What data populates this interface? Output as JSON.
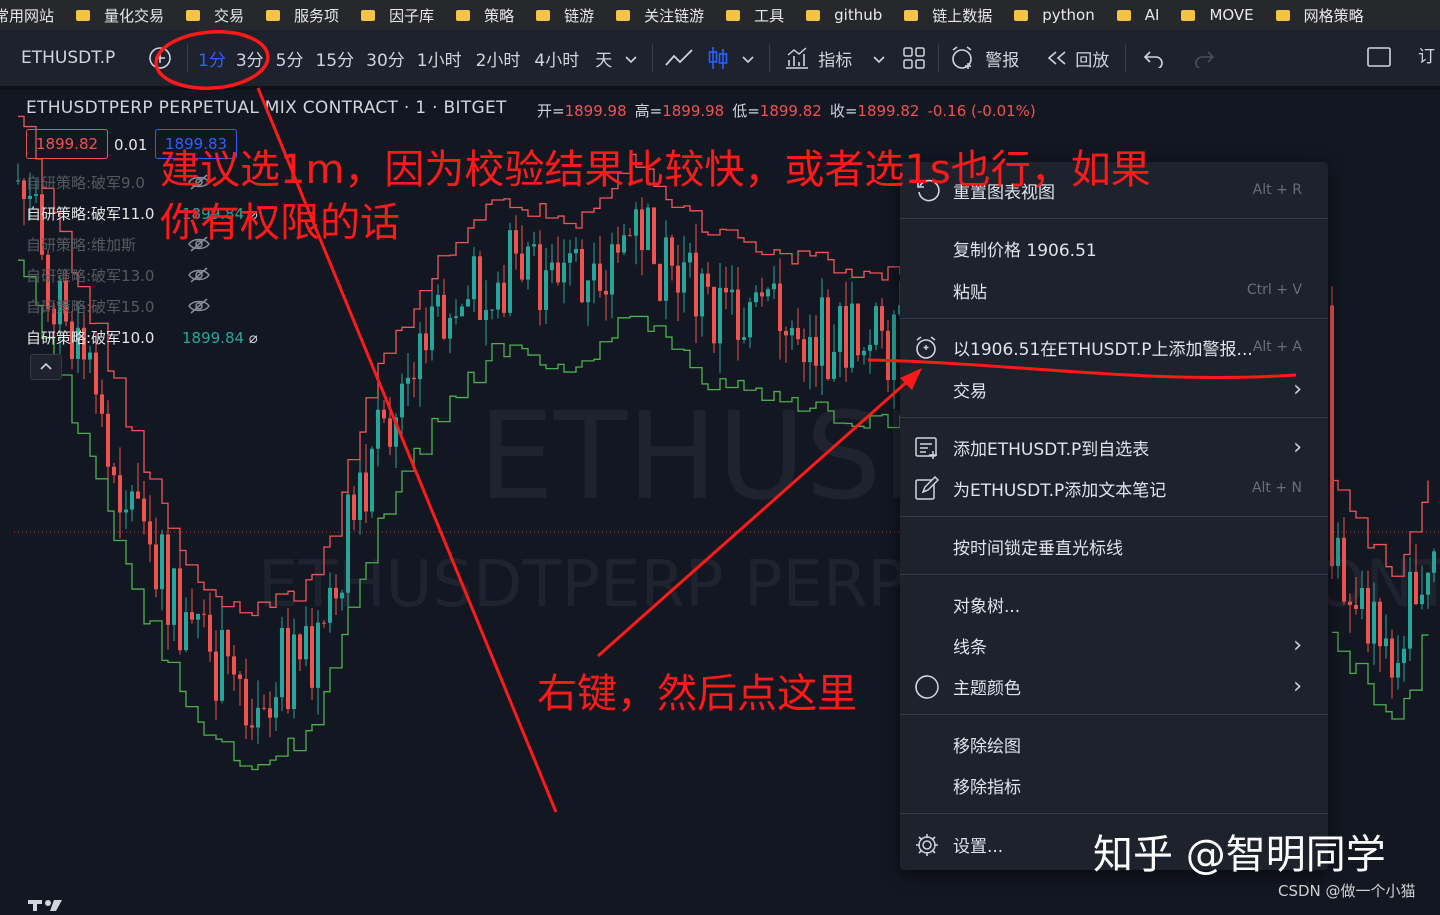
{
  "bookmarks": [
    "常用网站",
    "量化交易",
    "交易",
    "服务项",
    "因子库",
    "策略",
    "链游",
    "关注链游",
    "工具",
    "github",
    "链上数据",
    "python",
    "AI",
    "MOVE",
    "网格策略"
  ],
  "toolbar": {
    "symbol": "ETHUSDT.P",
    "intervals": [
      "1分",
      "3分",
      "5分",
      "15分",
      "30分",
      "1小时",
      "2小时",
      "4小时",
      "天"
    ],
    "indicators_label": "指标",
    "alert_label": "警报",
    "replay_label": "回放",
    "sub_label": "订"
  },
  "legend": {
    "title": "ETHUSDTPERP PERPETUAL MIX CONTRACT · 1 · BITGET",
    "ohlc": [
      {
        "k": "开=",
        "v": "1899.98"
      },
      {
        "k": "高=",
        "v": "1899.98"
      },
      {
        "k": "低=",
        "v": "1899.82"
      },
      {
        "k": "收=",
        "v": "1899.82"
      }
    ],
    "change": "-0.16 (-0.01%)",
    "bid": "1899.82",
    "spread": "0.01",
    "ask": "1899.83"
  },
  "strategies": [
    {
      "label": "自研策略:破军9.0",
      "value": "",
      "dim": true
    },
    {
      "label": "自研策略:破军11.0",
      "value": "1899.84",
      "dim": false
    },
    {
      "label": "自研策略:维加斯",
      "value": "",
      "dim": true
    },
    {
      "label": "自研策略:破军13.0",
      "value": "",
      "dim": true
    },
    {
      "label": "自研策略:破军15.0",
      "value": "",
      "dim": true
    },
    {
      "label": "自研策略:破军10.0",
      "value": "1899.84",
      "dim": false
    }
  ],
  "watermark": {
    "big": "ETHUSD",
    "desc": "ETHUSDTPERP PERPETUAL MIX CONTRACT"
  },
  "menu": {
    "reset": {
      "label": "重置图表视图",
      "shortcut": "Alt + R"
    },
    "copy_price": {
      "label": "复制价格 1906.51"
    },
    "paste": {
      "label": "粘贴",
      "shortcut": "Ctrl + V"
    },
    "add_alert": {
      "label": "以1906.51在ETHUSDT.P上添加警报...",
      "shortcut": "Alt + A"
    },
    "trade": {
      "label": "交易"
    },
    "add_watchlist": {
      "label": "添加ETHUSDT.P到自选表"
    },
    "add_note": {
      "label": "为ETHUSDT.P添加文本笔记",
      "shortcut": "Alt + N"
    },
    "lock_cursor": {
      "label": "按时间锁定垂直光标线"
    },
    "object_tree": {
      "label": "对象树..."
    },
    "lines": {
      "label": "线条"
    },
    "theme": {
      "label": "主题颜色"
    },
    "remove_drawings": {
      "label": "移除绘图"
    },
    "remove_indicators": {
      "label": "移除指标"
    },
    "settings": {
      "label": "设置..."
    }
  },
  "annotations": {
    "line1": "建议选1m，因为校验结果比较快，或者选1s也行，如果",
    "line2": "你有权限的话",
    "line3": "右键，然后点这里"
  },
  "watermarks": {
    "zhihu": "知乎 @智明同学",
    "csdn": "CSDN @做一个小猫"
  },
  "colors": {
    "up": "#26a69a",
    "down": "#ef5350",
    "annotation": "#ff1a1a",
    "active_interval": "#2962ff"
  }
}
